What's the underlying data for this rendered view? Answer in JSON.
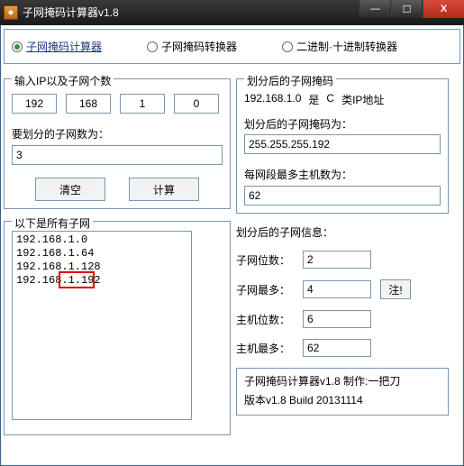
{
  "window": {
    "title": "子网掩码计算器v1.8"
  },
  "tabs": {
    "calc": "子网掩码计算器",
    "convert": "子网掩码转换器",
    "binary": "二进制·十进制转换器"
  },
  "gb": {
    "input": "输入IP以及子网个数",
    "resultMask": "划分后的子网掩码",
    "allSubnets": "以下是所有子网",
    "resultInfo": "划分后的子网信息："
  },
  "ip": {
    "o1": "192",
    "o2": "168",
    "o3": "1",
    "o4": "0"
  },
  "labels": {
    "subnetCount": "要划分的子网数为：",
    "maskAfter": "划分后的子网掩码为：",
    "maxHosts": "每网段最多主机数为：",
    "subnetBits": "子网位数：",
    "subnetMax": "子网最多：",
    "hostBits": "主机位数：",
    "hostMax": "主机最多：",
    "ipLine1": "192.168.1.0",
    "ipLine2": "是",
    "ipLine3": "C",
    "ipLine4": "类IP地址"
  },
  "buttons": {
    "clear": "清空",
    "compute": "计算",
    "note": "注!"
  },
  "values": {
    "subnetCountInput": "3",
    "mask": "255.255.255.192",
    "hostsPerSeg": "62",
    "subnetBits": "2",
    "subnetMax": "4",
    "hostBits": "6",
    "hostMax": "62"
  },
  "subnetList": "192.168.1.0\n192.168.1.64\n192.168.1.128\n192.168.1.192",
  "footer": {
    "l1": "子网掩码计算器v1.8  制作:一把刀",
    "l2": "版本v1.8  Build 20131114"
  }
}
